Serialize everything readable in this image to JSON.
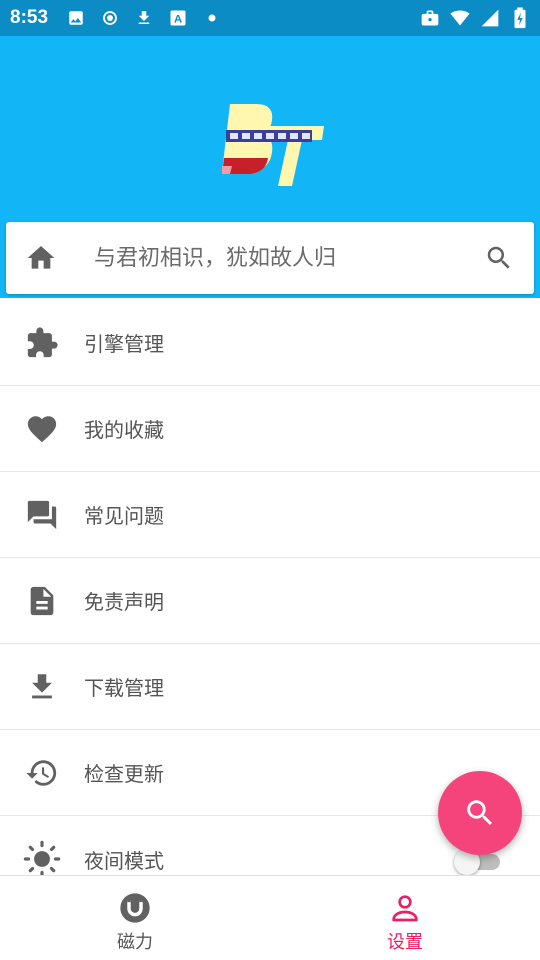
{
  "status_bar": {
    "time": "8:53",
    "left_icons": [
      "image-icon",
      "record-icon",
      "download-icon",
      "font-a-icon",
      "dot-icon"
    ],
    "right_icons": [
      "briefcase-icon",
      "wifi-icon",
      "signal-icon",
      "battery-charging-icon"
    ]
  },
  "header": {
    "logo_alt": "BT",
    "background_color": "#12b6f6"
  },
  "search": {
    "placeholder": "与君初相识，犹如故人归"
  },
  "menu": {
    "items": [
      {
        "label": "引擎管理",
        "icon": "puzzle-icon"
      },
      {
        "label": "我的收藏",
        "icon": "heart-icon"
      },
      {
        "label": "常见问题",
        "icon": "forum-icon"
      },
      {
        "label": "免责声明",
        "icon": "document-icon"
      },
      {
        "label": "下载管理",
        "icon": "download-icon"
      },
      {
        "label": "检查更新",
        "icon": "history-icon"
      },
      {
        "label": "夜间模式",
        "icon": "brightness-icon",
        "toggle": false
      }
    ]
  },
  "fab": {
    "icon": "search-icon",
    "color": "#f5447c"
  },
  "bottom_nav": {
    "items": [
      {
        "label": "磁力",
        "icon": "magnet-icon",
        "active": false
      },
      {
        "label": "设置",
        "icon": "person-icon",
        "active": true
      }
    ],
    "active_color": "#e91e63"
  }
}
